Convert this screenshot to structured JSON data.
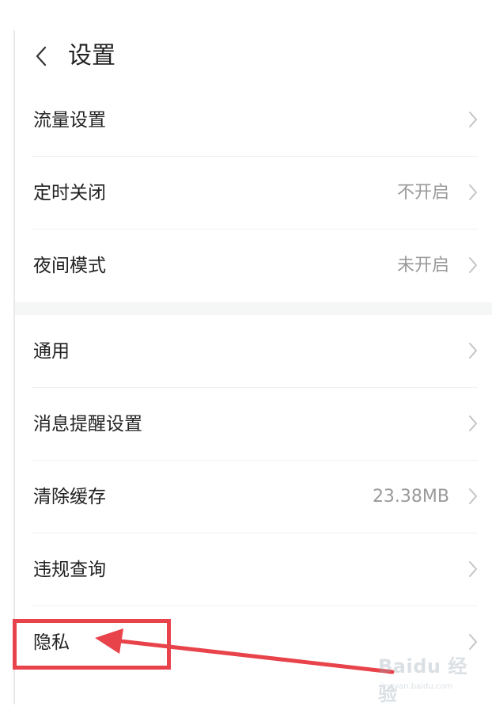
{
  "header": {
    "title": "设置",
    "back_icon": "chevron-left-icon"
  },
  "groups": [
    {
      "rows": [
        {
          "label": "流量设置",
          "value": ""
        },
        {
          "label": "定时关闭",
          "value": "不开启"
        },
        {
          "label": "夜间模式",
          "value": "未开启"
        }
      ]
    },
    {
      "rows": [
        {
          "label": "通用",
          "value": ""
        },
        {
          "label": "消息提醒设置",
          "value": ""
        },
        {
          "label": "清除缓存",
          "value": "23.38MB"
        },
        {
          "label": "违规查询",
          "value": ""
        },
        {
          "label": "隐私",
          "value": ""
        }
      ]
    }
  ],
  "annotation": {
    "highlight_color": "#e8434a"
  },
  "watermark": {
    "text": "Baidu 经验",
    "subtext": "jingyan.baidu.com"
  },
  "colors": {
    "background": "#ffffff",
    "text_primary": "#222222",
    "text_secondary": "#9a9a9a",
    "divider": "#f0f0f0",
    "section_gap": "#f5f6f6"
  }
}
